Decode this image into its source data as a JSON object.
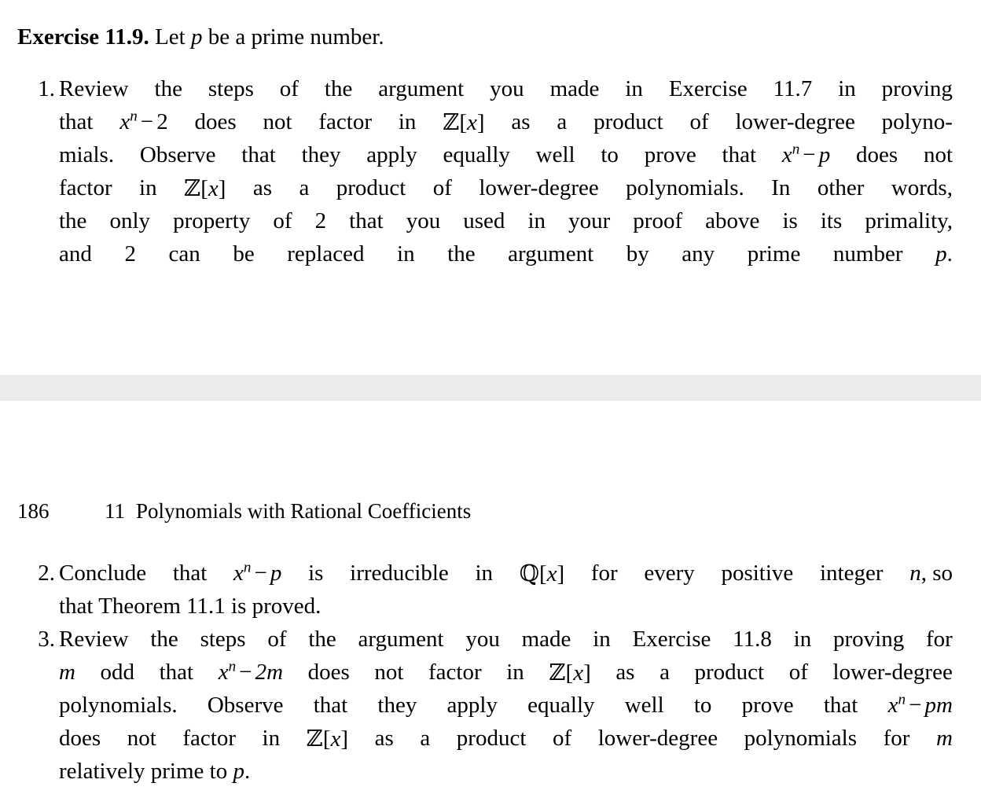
{
  "colors": {
    "page_background": "#ffffff",
    "text": "#000000",
    "separator_band": "#ebebeb"
  },
  "exercise": {
    "label": "Exercise 11.9.",
    "statement": "Let p be a prime number.",
    "statement_pre": "Let ",
    "statement_var": "p",
    "statement_post": " be a prime number."
  },
  "page_header": {
    "folio": "186",
    "chapter_number": "11",
    "chapter_title": "Polynomials with Rational Coefficients"
  },
  "items": [
    {
      "marker": "1.",
      "text": "Review the steps of the argument you made in Exercise 11.7 in proving that x^n - 2 does not factor in Z[x] as a product of lower-degree polynomials. Observe that they apply equally well to prove that x^n - p does not factor in Z[x] as a product of lower-degree polynomials. In other words, the only property of 2 that you used in your proof above is its primality, and 2 can be replaced in the argument by any prime number p.",
      "lines": [
        [
          "Review",
          "the",
          "steps",
          "of",
          "the",
          "argument",
          "you",
          "made",
          "in",
          "Exercise",
          "11.7",
          "in",
          "proving"
        ],
        [
          "that",
          "MATH_XN_MINUS_2",
          "does",
          "not",
          "factor",
          "in",
          "MATH_ZX",
          "as",
          "a",
          "product",
          "of",
          "lower-degree",
          "polyno-"
        ],
        [
          "mials. Observe that they apply equally well to prove that",
          "MATH_XN_MINUS_P",
          "does not"
        ],
        [
          "factor",
          "in",
          "MATH_ZX",
          "as",
          "a",
          "product",
          "of",
          "lower-degree",
          "polynomials.",
          "In",
          "other",
          "words,"
        ],
        [
          "the",
          "only",
          "property",
          "of",
          "2",
          "that",
          "you",
          "used",
          "in",
          "your",
          "proof",
          "above",
          "is",
          "its",
          "primality,"
        ],
        [
          "and",
          "2",
          "can",
          "be",
          "replaced",
          "in",
          "the",
          "argument",
          "by",
          "any",
          "prime",
          "number",
          "MATH_P."
        ]
      ]
    },
    {
      "marker": "2.",
      "text": "Conclude that x^n - p is irreducible in Q[x] for every positive integer n, so that Theorem 11.1 is proved."
    },
    {
      "marker": "3.",
      "text": "Review the steps of the argument you made in Exercise 11.8 in proving for m odd that x^n - 2m does not factor in Z[x] as a product of lower-degree polynomials. Observe that they apply equally well to prove that x^n - pm does not factor in Z[x] as a product of lower-degree polynomials for m relatively prime to p."
    }
  ],
  "item1": {
    "marker": "1.",
    "l1a": "Review",
    "l1b": "the",
    "l1c": "steps",
    "l1d": "of",
    "l1e": "the",
    "l1f": "argument",
    "l1g": "you",
    "l1h": "made",
    "l1i": "in",
    "l1j": "Exercise",
    "l1k": "11.7",
    "l1l": "in",
    "l1m": "proving",
    "l2a": "that",
    "l2b": "does",
    "l2c": "not",
    "l2d": "factor",
    "l2e": "in",
    "l2f": "as",
    "l2g": "a",
    "l2h": "product",
    "l2i": "of",
    "l2j": "lower-degree",
    "l2k": "polyno-",
    "l3a": "mials.",
    "l3b": "Observe",
    "l3c": "that",
    "l3d": "they",
    "l3e": "apply",
    "l3f": "equally",
    "l3g": "well",
    "l3h": "to",
    "l3i": "prove",
    "l3j": "that",
    "l3k": "does",
    "l3l": "not",
    "l4a": "factor",
    "l4b": "in",
    "l4c": "as",
    "l4d": "a",
    "l4e": "product",
    "l4f": "of",
    "l4g": "lower-degree",
    "l4h": "polynomials.",
    "l4i": "In",
    "l4j": "other",
    "l4k": "words,",
    "l5a": "the",
    "l5b": "only",
    "l5c": "property",
    "l5d": "of",
    "l5e": "2",
    "l5f": "that",
    "l5g": "you",
    "l5h": "used",
    "l5i": "in",
    "l5j": "your",
    "l5k": "proof",
    "l5l": "above",
    "l5m": "is",
    "l5n": "its",
    "l5o": "primality,",
    "l6a": "and",
    "l6b": "2",
    "l6c": "can",
    "l6d": "be",
    "l6e": "replaced",
    "l6f": "in",
    "l6g": "the",
    "l6h": "argument",
    "l6i": "by",
    "l6j": "any",
    "l6k": "prime",
    "l6l": "number",
    "l6m": "."
  },
  "item2": {
    "marker": "2.",
    "l1a": "Conclude",
    "l1b": "that",
    "l1c": "is",
    "l1d": "irreducible",
    "l1e": "in",
    "l1f": "for",
    "l1g": "every",
    "l1h": "positive",
    "l1i": "integer",
    "l1j": ", so",
    "l2a": "that Theorem 11.1 is proved."
  },
  "item3": {
    "marker": "3.",
    "l1a": "Review",
    "l1b": "the",
    "l1c": "steps",
    "l1d": "of",
    "l1e": "the",
    "l1f": "argument",
    "l1g": "you",
    "l1h": "made",
    "l1i": "in",
    "l1j": "Exercise",
    "l1k": "11.8",
    "l1l": "in",
    "l1m": "proving",
    "l1n": "for",
    "l2a": "odd",
    "l2b": "that",
    "l2c": "does",
    "l2d": "not",
    "l2e": "factor",
    "l2f": "in",
    "l2g": "as",
    "l2h": "a",
    "l2i": "product",
    "l2j": "of",
    "l2k": "lower-degree",
    "l3a": "polynomials.",
    "l3b": "Observe",
    "l3c": "that",
    "l3d": "they",
    "l3e": "apply",
    "l3f": "equally",
    "l3g": "well",
    "l3h": "to",
    "l3i": "prove",
    "l3j": "that",
    "l4a": "does",
    "l4b": "not",
    "l4c": "factor",
    "l4d": "in",
    "l4e": "as",
    "l4f": "a",
    "l4g": "product",
    "l4h": "of",
    "l4i": "lower-degree",
    "l4j": "polynomials",
    "l4k": "for",
    "l5a": "relatively prime to",
    "l5b": "."
  },
  "math": {
    "x": "x",
    "n": "n",
    "p": "p",
    "m": "m",
    "two": "2",
    "minus": "−",
    "Z": "ℤ",
    "Q": "ℚ",
    "bracket_open": "[",
    "bracket_close": "]",
    "two_m": "2m",
    "p_m": "pm"
  }
}
